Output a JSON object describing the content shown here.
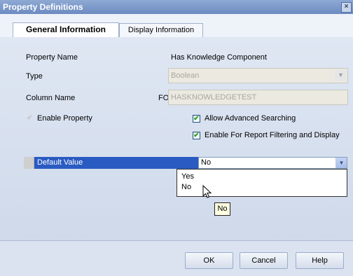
{
  "window": {
    "title": "Property Definitions",
    "close_glyph": "×"
  },
  "tabs": [
    {
      "label": "General Information",
      "active": true
    },
    {
      "label": "Display Information",
      "active": false
    }
  ],
  "form": {
    "property_name_label": "Property Name",
    "property_name_value": "Has Knowledge Component",
    "type_label": "Type",
    "type_value": "Boolean",
    "column_name_label": "Column Name",
    "column_name_prefix": "FO",
    "column_name_value": "HASKNOWLEDGETEST",
    "enable_property": {
      "label": "Enable Property",
      "checked": true,
      "disabled": true
    },
    "allow_advanced_searching": {
      "label": "Allow Advanced Searching",
      "checked": true
    },
    "enable_report_filtering": {
      "label": "Enable For Report Filtering and Display",
      "checked": true
    }
  },
  "default_value": {
    "label": "Default Value",
    "selected": "No",
    "options": [
      "Yes",
      "No"
    ]
  },
  "tooltip": {
    "text": "No"
  },
  "buttons": {
    "ok": "OK",
    "cancel": "Cancel",
    "help": "Help"
  },
  "colors": {
    "selection_blue": "#2a5bc2",
    "titlebar": "#7893c7",
    "checkmark_green": "#21a121"
  }
}
